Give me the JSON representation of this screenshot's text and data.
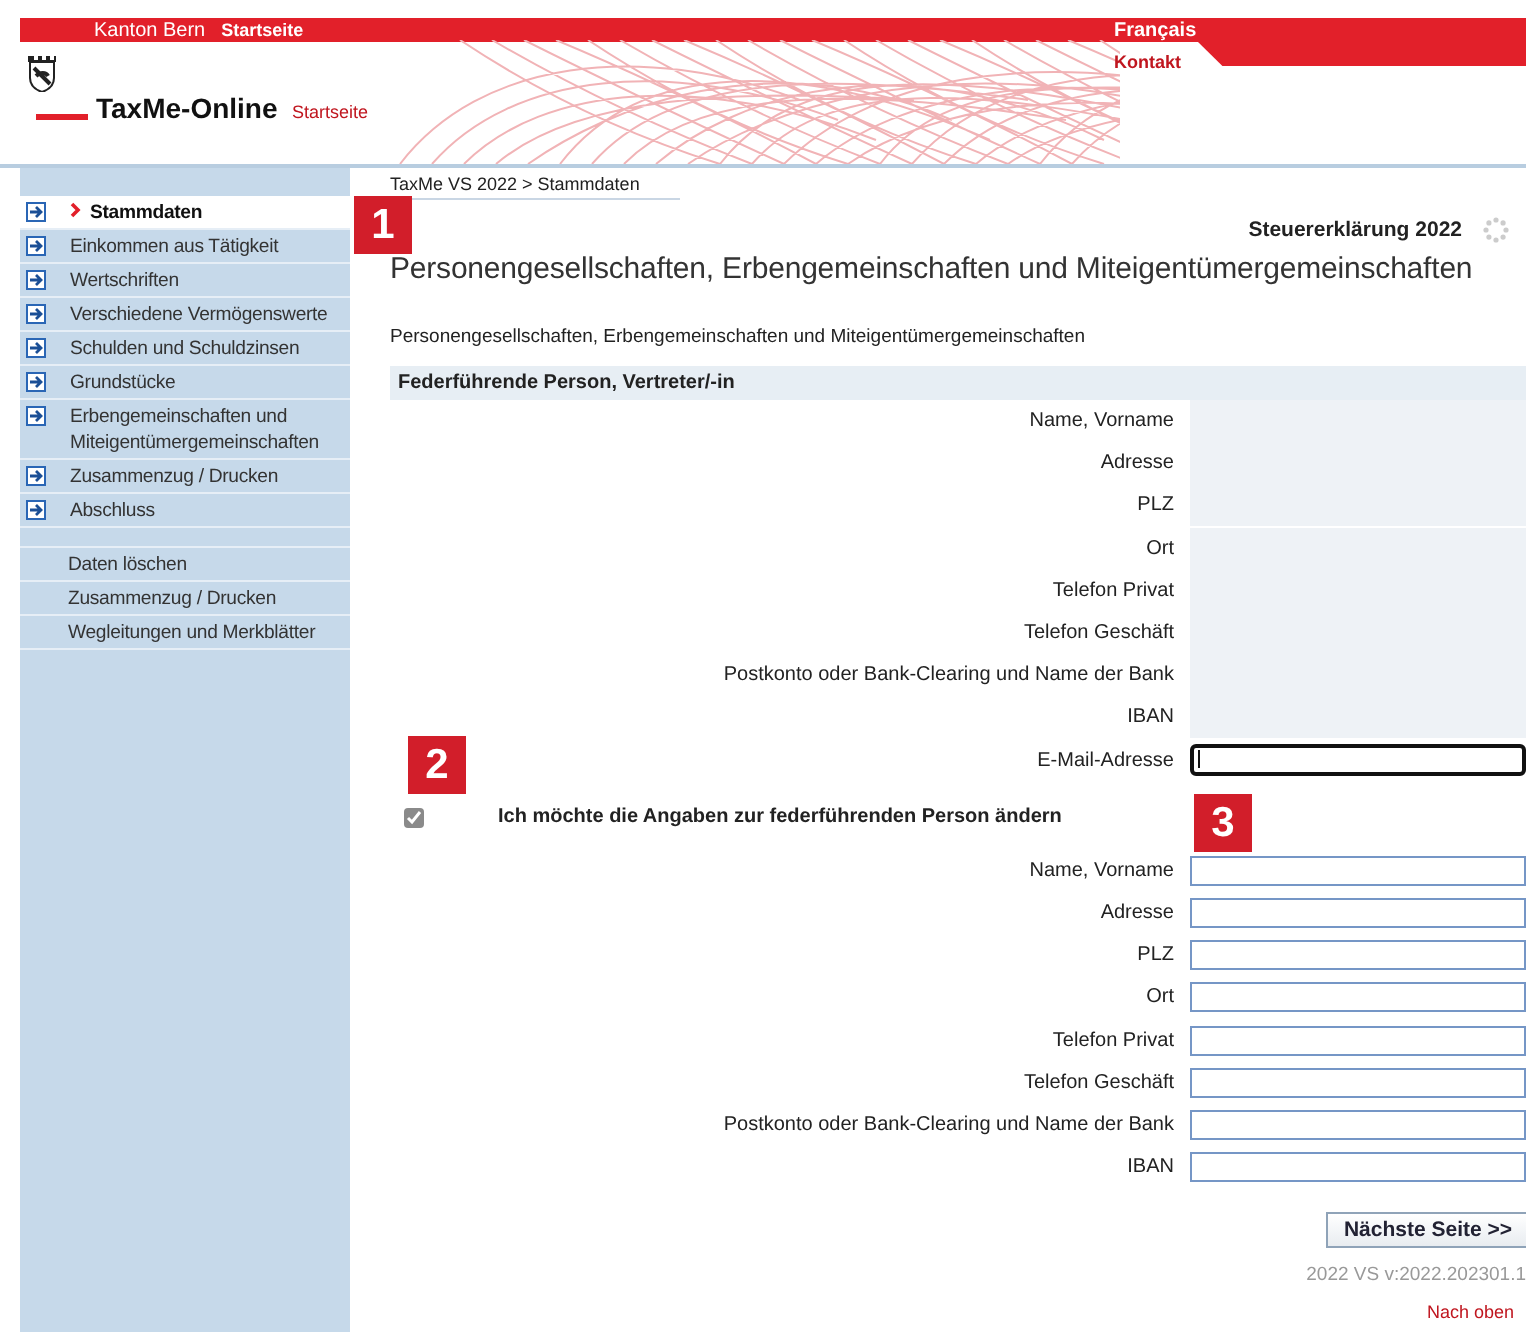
{
  "top_bar": {
    "left": [
      "Kanton Bern",
      "Startseite"
    ],
    "right": "Français"
  },
  "header": {
    "app_name": "TaxMe-Online",
    "home_link": "Startseite",
    "contact_link": "Kontakt"
  },
  "sidebar": {
    "steps": [
      {
        "label": "Stammdaten",
        "selected": true
      },
      {
        "label": "Einkommen aus Tätigkeit",
        "selected": false
      },
      {
        "label": "Wertschriften",
        "selected": false
      },
      {
        "label": "Verschiedene Vermögenswerte",
        "selected": false
      },
      {
        "label": "Schulden und Schuldzinsen",
        "selected": false
      },
      {
        "label": "Grundstücke",
        "selected": false
      },
      {
        "label": "Erbengemeinschaften und Miteigentümergemeinschaften",
        "selected": false
      },
      {
        "label": "Zusammenzug / Drucken",
        "selected": false
      },
      {
        "label": "Abschluss",
        "selected": false
      }
    ],
    "links": [
      "Daten löschen",
      "Zusammenzug / Drucken",
      "Wegleitungen und Merkblätter"
    ]
  },
  "breadcrumb": "TaxMe VS 2022 > Stammdaten",
  "form_title": "Steuererklärung 2022",
  "page_title": "Personengesellschaften, Erbengemeinschaften und Miteigentümergemeinschaften",
  "subtitle": "Personengesellschaften, Erbengemeinschaften und Miteigentümergemeinschaften",
  "section_title": "Federführende Person, Vertreter/-in",
  "current_fields": [
    {
      "label": "Name, Vorname",
      "kind": "readonly"
    },
    {
      "label": "Adresse",
      "kind": "readonly"
    },
    {
      "label": "PLZ",
      "kind": "readonly"
    },
    {
      "label": "Ort",
      "kind": "readonly"
    },
    {
      "label": "Telefon Privat",
      "kind": "readonly"
    },
    {
      "label": "Telefon Geschäft",
      "kind": "readonly"
    },
    {
      "label": "Postkonto oder Bank-Clearing und Name der Bank",
      "kind": "readonly"
    },
    {
      "label": "IBAN",
      "kind": "readonly"
    },
    {
      "label": "E-Mail-Adresse",
      "kind": "input",
      "focused": true
    }
  ],
  "change_checkbox": {
    "label": "Ich möchte die Angaben zur federführenden Person ändern",
    "checked": true,
    "disabled": true
  },
  "new_fields": [
    {
      "label": "Name, Vorname",
      "kind": "input",
      "focused": false
    },
    {
      "label": "Adresse",
      "kind": "input",
      "focused": false
    },
    {
      "label": "PLZ",
      "kind": "input",
      "focused": false
    },
    {
      "label": "Ort",
      "kind": "input",
      "focused": false
    },
    {
      "label": "Telefon Privat",
      "kind": "input",
      "focused": false
    },
    {
      "label": "Telefon Geschäft",
      "kind": "input",
      "focused": false
    },
    {
      "label": "Postkonto oder Bank-Clearing und Name der Bank",
      "kind": "input",
      "focused": false
    },
    {
      "label": "IBAN",
      "kind": "input",
      "focused": false
    }
  ],
  "next_button": "Nächste Seite >>",
  "version": "2022 VS v:2022.202301.1",
  "back_to_top": "Nach oben",
  "callouts": [
    "1",
    "2",
    "3"
  ]
}
